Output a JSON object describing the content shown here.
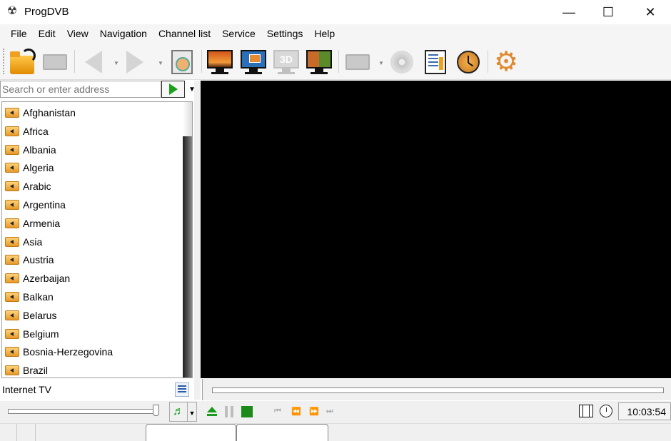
{
  "window": {
    "title": "ProgDVB",
    "minimize_label": "—",
    "maximize_label": "☐",
    "close_label": "✕"
  },
  "menu": [
    "File",
    "Edit",
    "View",
    "Navigation",
    "Channel list",
    "Service",
    "Settings",
    "Help"
  ],
  "toolbar": {
    "buttons": [
      {
        "name": "open",
        "icon": "open-folder-icon",
        "enabled": true
      },
      {
        "name": "recordings",
        "icon": "film-icon",
        "enabled": false
      },
      {
        "name": "back",
        "icon": "arrow-left-icon",
        "enabled": false
      },
      {
        "name": "forward",
        "icon": "arrow-right-icon",
        "enabled": false
      },
      {
        "name": "channel-search",
        "icon": "search-icon",
        "enabled": true
      },
      {
        "name": "fullscreen",
        "icon": "monitor-sunset-icon",
        "enabled": true
      },
      {
        "name": "picture-in-picture",
        "icon": "monitor-pip-icon",
        "enabled": true
      },
      {
        "name": "3d-mode",
        "icon": "monitor-3d-icon",
        "enabled": false,
        "label": "3D"
      },
      {
        "name": "mosaic",
        "icon": "monitor-mosaic-icon",
        "enabled": true
      },
      {
        "name": "record-list",
        "icon": "film-icon",
        "enabled": false
      },
      {
        "name": "disc",
        "icon": "disc-icon",
        "enabled": false
      },
      {
        "name": "epg-info",
        "icon": "info-icon",
        "enabled": true
      },
      {
        "name": "scheduler",
        "icon": "clock-icon",
        "enabled": true
      },
      {
        "name": "settings",
        "icon": "gear-icon",
        "enabled": true
      }
    ]
  },
  "search": {
    "placeholder": "Search or enter address",
    "value": ""
  },
  "channel_list": {
    "items": [
      "Afghanistan",
      "Africa",
      "Albania",
      "Algeria",
      "Arabic",
      "Argentina",
      "Armenia",
      "Asia",
      "Austria",
      "Azerbaijan",
      "Balkan",
      "Belarus",
      "Belgium",
      "Bosnia-Herzegovina",
      "Brazil"
    ]
  },
  "group": {
    "label": "Internet TV"
  },
  "player": {
    "volume_fraction": 1.0,
    "seek_fraction": 0.0,
    "audio_icon": "♬",
    "dropdown_glyph": "▼",
    "clock": "10:03:54",
    "nav_buttons": [
      "⏮",
      "⏪",
      "⏩",
      "⏭"
    ]
  }
}
